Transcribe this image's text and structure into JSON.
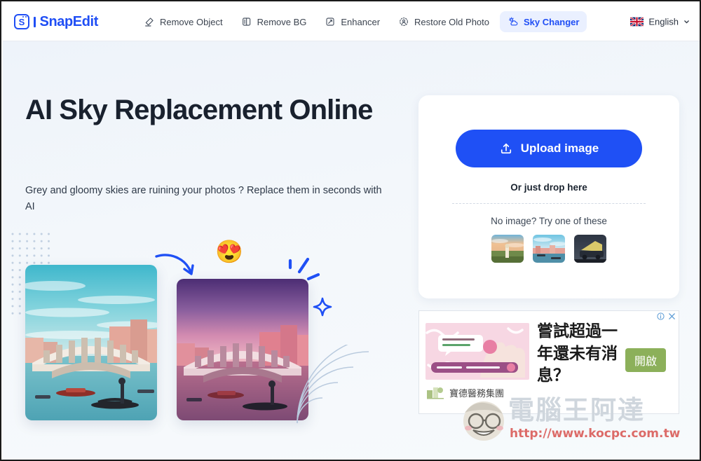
{
  "header": {
    "logo_text": "SnapEdit",
    "logo_icon": "snapedit-logo-icon",
    "nav": [
      {
        "label": "Remove Object",
        "icon": "eraser-icon",
        "active": false
      },
      {
        "label": "Remove BG",
        "icon": "remove-bg-icon",
        "active": false
      },
      {
        "label": "Enhancer",
        "icon": "enhancer-icon",
        "active": false
      },
      {
        "label": "Restore Old Photo",
        "icon": "restore-photo-icon",
        "active": false
      },
      {
        "label": "Sky Changer",
        "icon": "sky-changer-icon",
        "active": true
      }
    ],
    "language": {
      "label": "English",
      "flag_icon": "uk-flag-icon",
      "chevron_icon": "chevron-down-icon"
    }
  },
  "hero": {
    "title": "AI Sky Replacement Online",
    "subtitle": "Grey and gloomy skies are ruining your photos ? Replace them in seconds with AI",
    "before_image_alt": "venice-rialto-bridge-original-sky",
    "after_image_alt": "venice-rialto-bridge-purple-sunset-sky",
    "emoji": "😍",
    "decorations": [
      "dot-grid",
      "curved-arrow",
      "sparkle-lines",
      "sparkle-star",
      "concentric-arcs"
    ]
  },
  "upload": {
    "button_label": "Upload image",
    "button_icon": "upload-icon",
    "drop_text": "Or just drop here",
    "try_text": "No image? Try one of these",
    "samples": [
      {
        "alt": "sample-woman-in-field-sunset"
      },
      {
        "alt": "sample-venice-canal-town"
      },
      {
        "alt": "sample-vintage-car-night"
      }
    ],
    "accent_color": "#1f50f5"
  },
  "ad": {
    "headline": "嘗試超過一年還未有消息？",
    "cta_label": "開啟",
    "brand": "寶德醫務集團",
    "info_icon": "adchoices-info-icon",
    "close_icon": "close-icon",
    "image_alt": "pink-hands-fertility-ad-banner",
    "cta_color": "#8cb05a"
  },
  "watermark": {
    "text": "電腦王阿達",
    "url": "http://www.kocpc.com.tw",
    "face_icon": "mascot-face-icon"
  }
}
